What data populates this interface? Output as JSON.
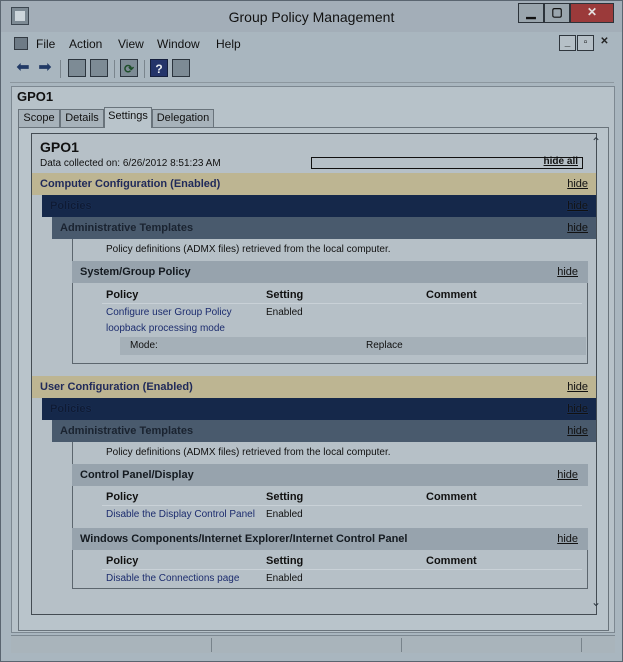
{
  "window": {
    "title": "Group Policy Management"
  },
  "menu": {
    "items": [
      "File",
      "Action",
      "View",
      "Window",
      "Help"
    ]
  },
  "toolbar": {
    "buttons": [
      "back-arrow-icon",
      "forward-arrow-icon",
      "up-folder-icon",
      "show-hide-tree-icon",
      "refresh-icon",
      "help-icon",
      "properties-icon"
    ]
  },
  "gpo": {
    "name": "GPO1"
  },
  "tabs": [
    "Scope",
    "Details",
    "Settings",
    "Delegation"
  ],
  "active_tab": "Settings",
  "report": {
    "title": "GPO1",
    "data_collected": "Data collected on: 6/26/2012 8:51:23 AM",
    "hide_all": "hide all",
    "hide": "hide",
    "computer": {
      "header": "Computer Configuration (Enabled)",
      "policies": "Policies",
      "admin_templates": "Administrative Templates",
      "admx_note": "Policy definitions (ADMX files) retrieved from the local computer.",
      "section": "System/Group Policy",
      "columns": [
        "Policy",
        "Setting",
        "Comment"
      ],
      "policy_line1": "Configure user Group Policy",
      "policy_line2": "loopback processing mode",
      "setting": "Enabled",
      "mode_label": "Mode:",
      "mode_value": "Replace"
    },
    "user": {
      "header": "User Configuration (Enabled)",
      "policies": "Policies",
      "admin_templates": "Administrative Templates",
      "admx_note": "Policy definitions (ADMX files) retrieved from the local computer.",
      "section1": "Control Panel/Display",
      "columns": [
        "Policy",
        "Setting",
        "Comment"
      ],
      "policy1": "Disable the Display Control Panel",
      "setting1": "Enabled",
      "section2": "Windows Components/Internet Explorer/Internet Control Panel",
      "policy2": "Disable the Connections page",
      "setting2": "Enabled"
    }
  }
}
